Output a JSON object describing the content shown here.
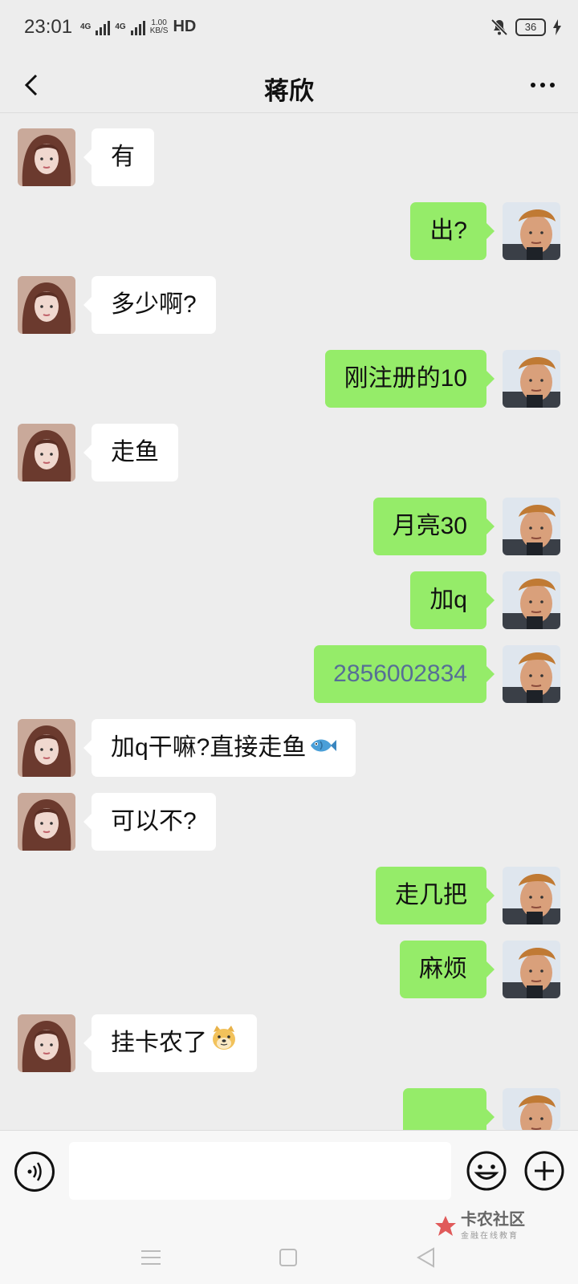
{
  "status_bar": {
    "time": "23:01",
    "network": "4G",
    "network2": "4G",
    "speed_value": "1.00",
    "speed_unit": "KB/S",
    "hd": "HD",
    "battery": "36"
  },
  "header": {
    "title": "蒋欣"
  },
  "messages": [
    {
      "from": "her",
      "text": "有"
    },
    {
      "from": "me",
      "text": "出?"
    },
    {
      "from": "her",
      "text": "多少啊?"
    },
    {
      "from": "me",
      "text": "刚注册的10"
    },
    {
      "from": "her",
      "text": "走鱼"
    },
    {
      "from": "me",
      "text": "月亮30"
    },
    {
      "from": "me",
      "text": "加q"
    },
    {
      "from": "me",
      "text": "2856002834"
    },
    {
      "from": "her",
      "text": "加q干嘛?直接走鱼",
      "emoji": "fish-emoji"
    },
    {
      "from": "her",
      "text": "可以不?"
    },
    {
      "from": "me",
      "text": "走几把"
    },
    {
      "from": "me",
      "text": "麻烦"
    },
    {
      "from": "her",
      "text": "挂卡农了",
      "emoji": "doge-emoji"
    }
  ],
  "input_bar": {
    "icons": [
      "voice-icon",
      "emoji-icon",
      "plus-icon"
    ]
  },
  "watermark": {
    "title": "卡农社区",
    "subtitle": "金融在线教育"
  },
  "colors": {
    "incoming": "#ffffff",
    "outgoing": "#95ec69",
    "background": "#ededed",
    "link": "#566e96"
  }
}
